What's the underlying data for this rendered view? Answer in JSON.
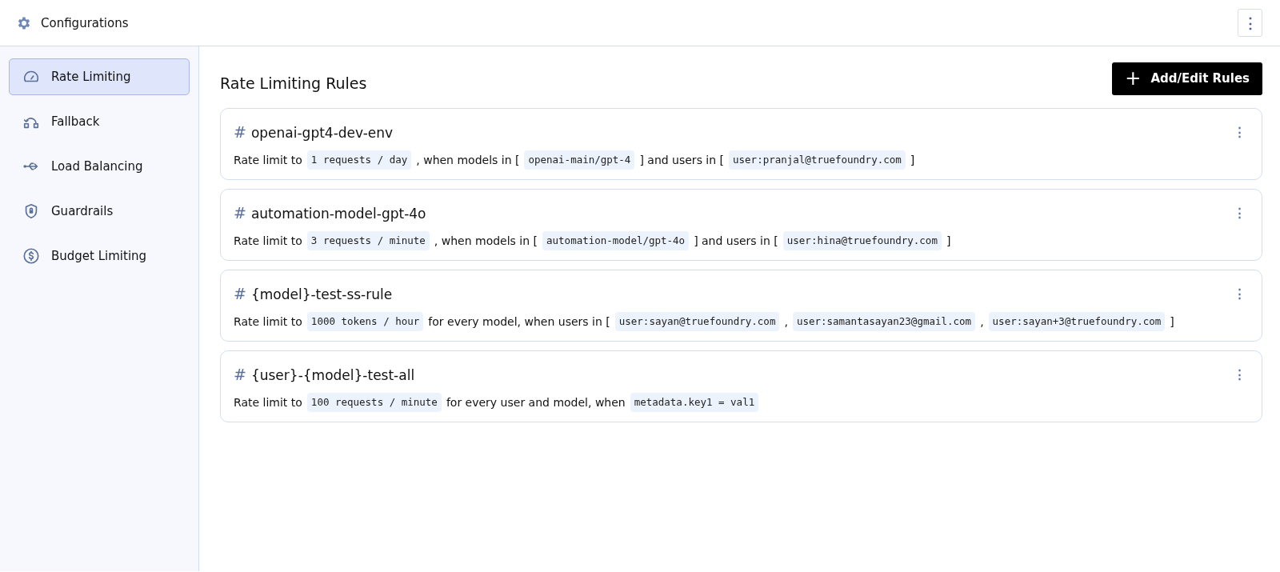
{
  "header": {
    "title": "Configurations",
    "menu": "⋮"
  },
  "sidebar": {
    "items": [
      {
        "label": "Rate Limiting",
        "selected": true
      },
      {
        "label": "Fallback",
        "selected": false
      },
      {
        "label": "Load Balancing",
        "selected": false
      },
      {
        "label": "Guardrails",
        "selected": false
      },
      {
        "label": "Budget Limiting",
        "selected": false
      }
    ]
  },
  "main": {
    "title": "Rate Limiting Rules",
    "add_button": {
      "icon": "+",
      "label": "Add/Edit Rules"
    },
    "rules": [
      {
        "hash": "#",
        "name": "openai-gpt4-dev-env",
        "menu": "⋮",
        "parts": [
          {
            "kind": "text",
            "text": "Rate limit to"
          },
          {
            "kind": "code",
            "text": "1 requests / day"
          },
          {
            "kind": "text",
            "text": ", when models in ["
          },
          {
            "kind": "code",
            "text": "openai-main/gpt-4"
          },
          {
            "kind": "text",
            "text": "] and users in ["
          },
          {
            "kind": "code",
            "text": "user:pranjal@truefoundry.com"
          },
          {
            "kind": "text",
            "text": "]"
          }
        ]
      },
      {
        "hash": "#",
        "name": "automation-model-gpt-4o",
        "menu": "⋮",
        "parts": [
          {
            "kind": "text",
            "text": "Rate limit to"
          },
          {
            "kind": "code",
            "text": "3 requests / minute"
          },
          {
            "kind": "text",
            "text": ", when models in ["
          },
          {
            "kind": "code",
            "text": "automation-model/gpt-4o"
          },
          {
            "kind": "text",
            "text": "] and users in ["
          },
          {
            "kind": "code",
            "text": "user:hina@truefoundry.com"
          },
          {
            "kind": "text",
            "text": "]"
          }
        ]
      },
      {
        "hash": "#",
        "name": "{model}-test-ss-rule",
        "menu": "⋮",
        "parts": [
          {
            "kind": "text",
            "text": "Rate limit to"
          },
          {
            "kind": "code",
            "text": "1000 tokens / hour"
          },
          {
            "kind": "text",
            "text": "for every model, when users in ["
          },
          {
            "kind": "code",
            "text": "user:sayan@truefoundry.com"
          },
          {
            "kind": "text",
            "text": ","
          },
          {
            "kind": "code",
            "text": "user:samantasayan23@gmail.com"
          },
          {
            "kind": "text",
            "text": ","
          },
          {
            "kind": "code",
            "text": "user:sayan+3@truefoundry.com"
          },
          {
            "kind": "text",
            "text": "]"
          }
        ]
      },
      {
        "hash": "#",
        "name": "{user}-{model}-test-all",
        "menu": "⋮",
        "parts": [
          {
            "kind": "text",
            "text": "Rate limit to"
          },
          {
            "kind": "code",
            "text": "100 requests / minute"
          },
          {
            "kind": "text",
            "text": "for every user and model, when"
          },
          {
            "kind": "code",
            "text": "metadata.key1 = val1"
          }
        ]
      }
    ]
  }
}
